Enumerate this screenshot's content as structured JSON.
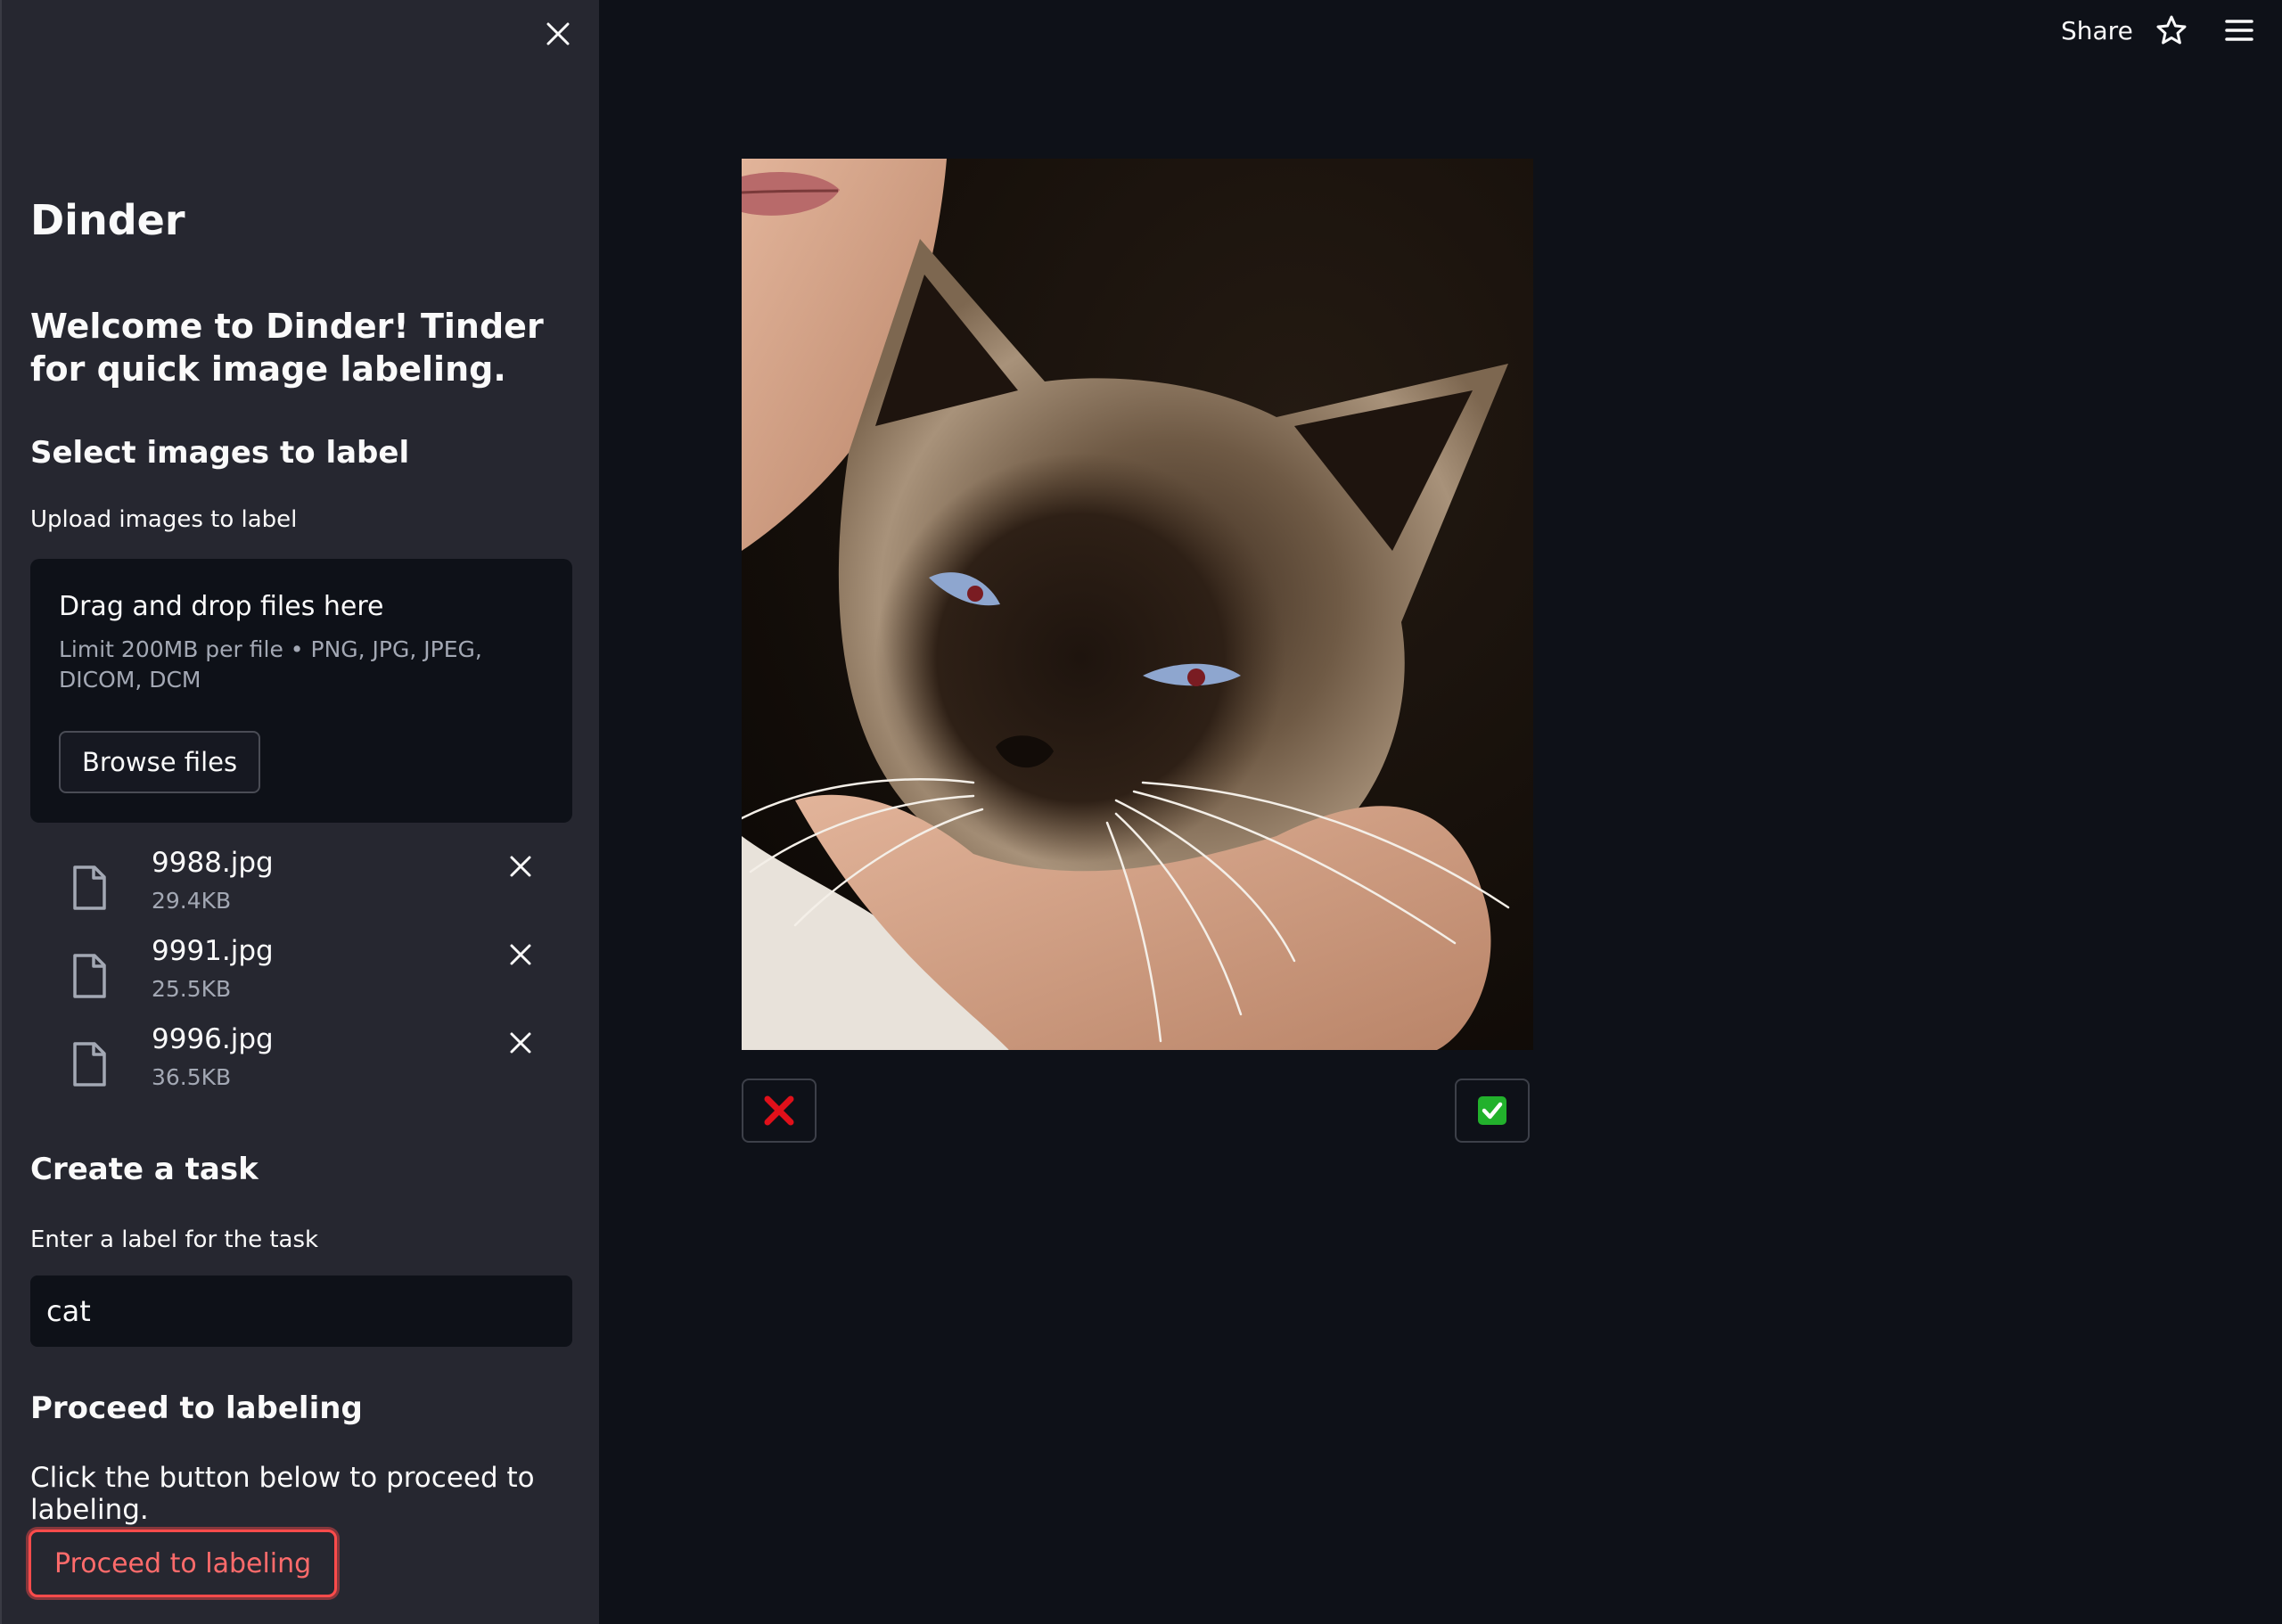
{
  "sidebar": {
    "title": "Dinder",
    "welcome": "Welcome to Dinder! Tinder for quick image labeling.",
    "select_heading": "Select images to label",
    "upload_label": "Upload images to label",
    "dropzone": {
      "title": "Drag and drop files here",
      "limit": "Limit 200MB per file • PNG, JPG, JPEG, DICOM, DCM",
      "browse_label": "Browse files"
    },
    "files": [
      {
        "name": "9988.jpg",
        "size": "29.4KB"
      },
      {
        "name": "9991.jpg",
        "size": "25.5KB"
      },
      {
        "name": "9996.jpg",
        "size": "36.5KB"
      }
    ],
    "task_heading": "Create a task",
    "task_label": "Enter a label for the task",
    "task_value": "cat",
    "proceed_heading": "Proceed to labeling",
    "proceed_text": "Click the button below to proceed to labeling.",
    "proceed_button": "Proceed to labeling"
  },
  "topbar": {
    "share_label": "Share",
    "icons": [
      "star-icon",
      "hamburger-menu-icon"
    ]
  },
  "main": {
    "image_subject": "siamese-cat-photo",
    "reject_icon": "red-x-icon",
    "accept_icon": "green-check-icon"
  },
  "colors": {
    "background": "#0e1118",
    "sidebar": "#262730",
    "accent": "#ff4b4b",
    "accept": "#22b12c",
    "reject": "#e0101a"
  }
}
